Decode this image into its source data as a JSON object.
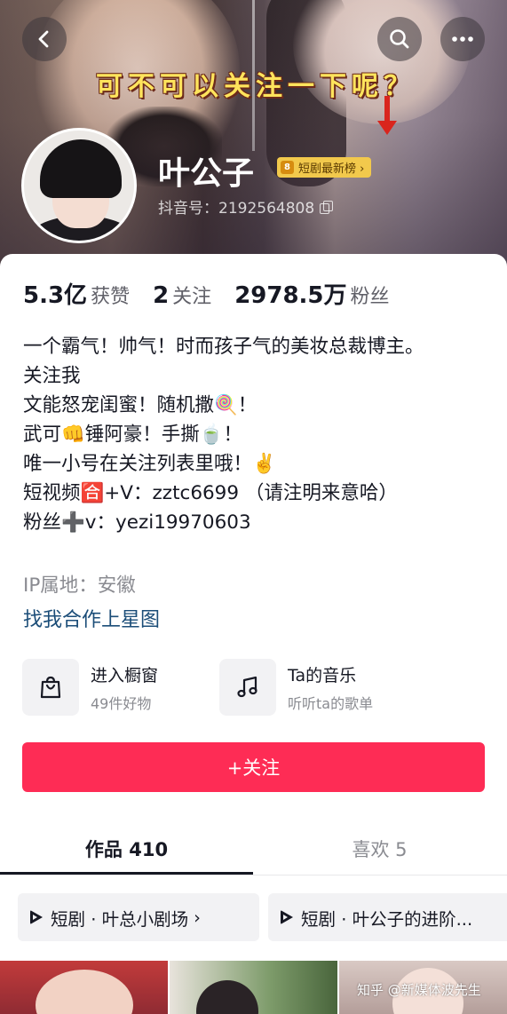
{
  "header": {
    "banner_caption": "可不可以关注一下呢？",
    "nickname": "叶公子",
    "rank_badge_num": "8",
    "rank_badge_label": "短剧最新榜 ›",
    "douyin_id": "抖音号：2192564808"
  },
  "stats": [
    {
      "value": "5.3亿",
      "label": "获赞"
    },
    {
      "value": "2",
      "label": "关注"
    },
    {
      "value": "2978.5万",
      "label": "粉丝"
    }
  ],
  "bio": {
    "line1": "一个霸气！帅气！时而孩子气的美妆总裁博主。",
    "line2": "关注我",
    "line3": "文能怒宠闺蜜！随机撒🍭！",
    "line4": "武可👊锤阿豪！手撕🍵！",
    "line5": "唯一小号在关注列表里哦！✌️",
    "line6": "短视频🈴+V：zztc6699 （请注明来意哈）",
    "line7": "粉丝➕v：yezi19970603"
  },
  "ip_location": "IP属地：安徽",
  "star_link": "找我合作上星图",
  "entries": {
    "shop_title": "进入橱窗",
    "shop_sub": "49件好物",
    "music_title": "Ta的音乐",
    "music_sub": "听听ta的歌单"
  },
  "follow_button": "+关注",
  "tabs": {
    "works": "作品 410",
    "likes": "喜欢 5"
  },
  "collections": {
    "chip1": "短剧 · 叶总小剧场",
    "chip1_arrow": "›",
    "chip2": "短剧 · 叶公子的进阶..."
  },
  "watermark": "知乎 @新媒体波先生",
  "colors": {
    "follow_red": "#fe2c55",
    "link_blue": "#1b4d78",
    "caption_yellow": "#ffe45c",
    "badge_gold": "#f2c94c"
  },
  "icons": [
    "back-arrow-icon",
    "search-icon",
    "more-icon",
    "copy-icon",
    "shopping-bag-icon",
    "music-note-icon",
    "play-icon",
    "chevron-right-icon"
  ]
}
